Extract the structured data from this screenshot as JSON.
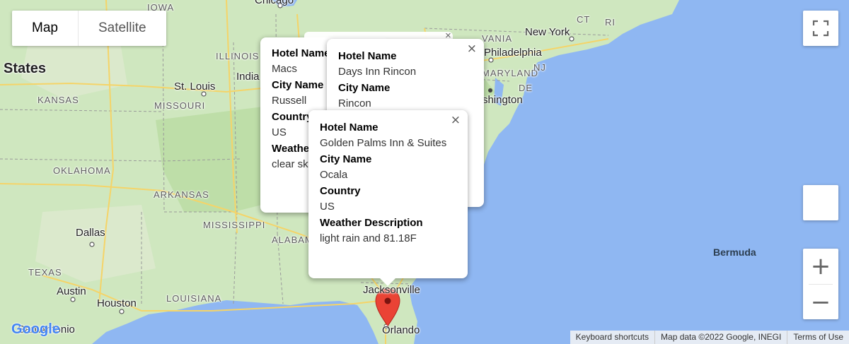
{
  "map_type": {
    "options": [
      "Map",
      "Satellite"
    ],
    "selected": "Map"
  },
  "labels": {
    "states": [
      "IOWA",
      "ILLINOIS",
      "KANSAS",
      "MISSOURI",
      "OKLAHOMA",
      "ARKANSAS",
      "MISSISSIPPI",
      "ALABAMA",
      "TEXAS",
      "LOUISIANA",
      "VANIA",
      "MARYLAND",
      "DE",
      "NJ",
      "CT",
      "RI"
    ],
    "cities": [
      "Chicago",
      "St. Louis",
      "Dallas",
      "Austin",
      "Houston",
      "San Antonio",
      "Jacksonville",
      "Orlando",
      "New York",
      "Philadelphia",
      "Washington",
      "India"
    ],
    "country": "States",
    "ocean": "Bermuda"
  },
  "info_windows": [
    {
      "fields": [
        {
          "key": "Hotel Name",
          "value": "Macs"
        },
        {
          "key": "City Name",
          "value": "Russell"
        },
        {
          "key": "Country",
          "value": "US"
        },
        {
          "key": "Weather Description",
          "value": "clear sky"
        }
      ]
    },
    {
      "fields": [
        {
          "key": "Hotel Name",
          "value": "Days Inn Rincon"
        },
        {
          "key": "City Name",
          "value": "Rincon"
        }
      ]
    },
    {
      "fields": [
        {
          "key": "Hotel Name",
          "value": "Golden Palms Inn & Suites"
        },
        {
          "key": "City Name",
          "value": "Ocala"
        },
        {
          "key": "Country",
          "value": "US"
        },
        {
          "key": "Weather Description",
          "value": "light rain and 81.18F"
        }
      ]
    }
  ],
  "close_glyph": "×",
  "zoom": {
    "in": "+",
    "out": "−"
  },
  "logo": "Google",
  "attribution": [
    "Keyboard shortcuts",
    "Map data ©2022 Google, INEGI",
    "Terms of Use"
  ],
  "colors": {
    "land": "#cfe7bf",
    "water": "#8fb7f2",
    "highway": "#f5d468",
    "marker": "#ea4335"
  },
  "icons": {
    "fullscreen": "fullscreen-icon",
    "pegman": "pegman-icon",
    "marker": "map-marker-icon"
  }
}
